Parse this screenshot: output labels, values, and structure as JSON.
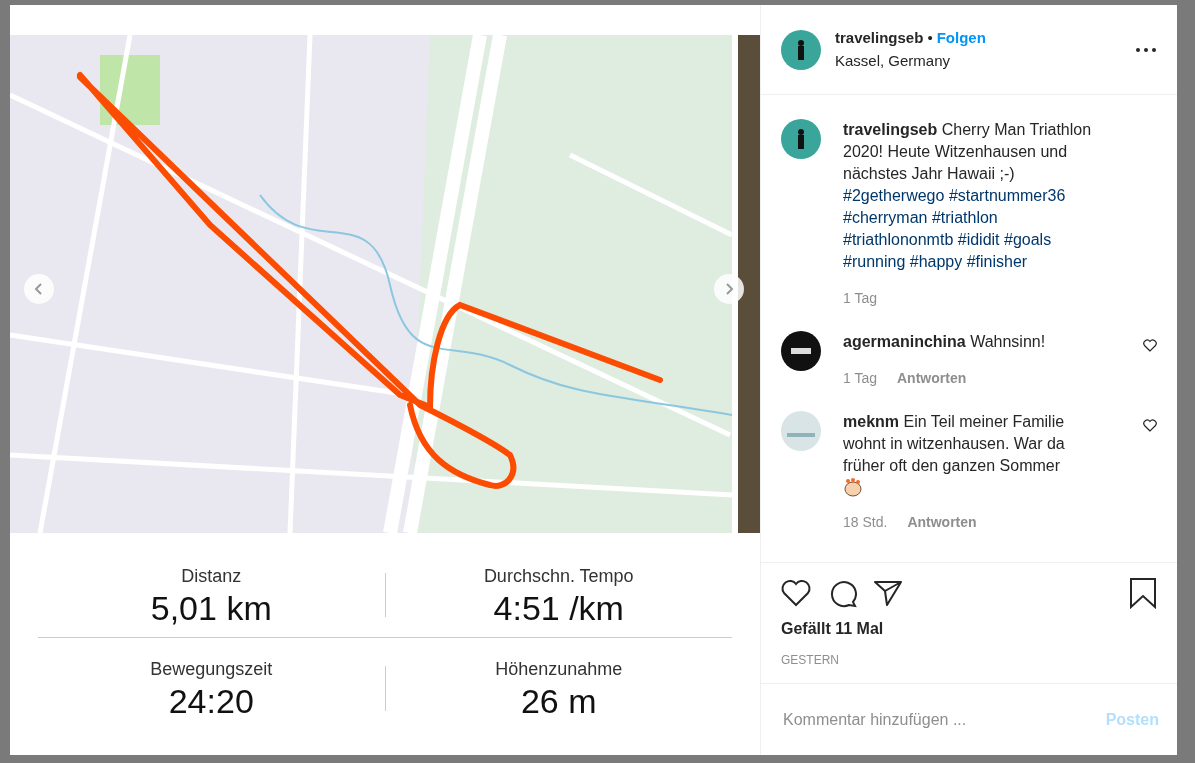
{
  "post": {
    "activity_stats": [
      {
        "label": "Distanz",
        "value": "5,01 km"
      },
      {
        "label": "Durchschn. Tempo",
        "value": "4:51 /km"
      },
      {
        "label": "Bewegungszeit",
        "value": "24:20"
      },
      {
        "label": "Höhenzunahme",
        "value": "26 m"
      }
    ],
    "header": {
      "username": "travelingseb",
      "separator": "•",
      "follow": "Folgen",
      "location": "Kassel, Germany"
    },
    "caption": {
      "username": "travelingseb",
      "text": "Cherry Man Triathlon 2020! Heute Witzenhausen und nächstes Jahr Hawaii ;-)",
      "hashtags": [
        "#2getherwego",
        "#startnummer36",
        "#cherryman",
        "#triathlon",
        "#triathlononmtb",
        "#ididit",
        "#goals",
        "#running",
        "#happy",
        "#finisher"
      ],
      "time": "1 Tag"
    },
    "comments": [
      {
        "username": "agermaninchina",
        "text": "Wahnsinn!",
        "time": "1 Tag",
        "reply": "Antworten",
        "liked": false,
        "kind": "dark"
      },
      {
        "username": "meknm",
        "text": "Ein Teil meiner Familie wohnt in witzenhausen. War da früher oft den ganzen Sommer",
        "time": "18 Std.",
        "reply": "Antworten",
        "liked": false,
        "kind": "light",
        "clap": true
      }
    ],
    "likes": "Gefällt 11 Mal",
    "date": "GESTERN",
    "comment_field": {
      "placeholder": "Kommentar hinzufügen ..."
    },
    "post_button": "Posten"
  }
}
